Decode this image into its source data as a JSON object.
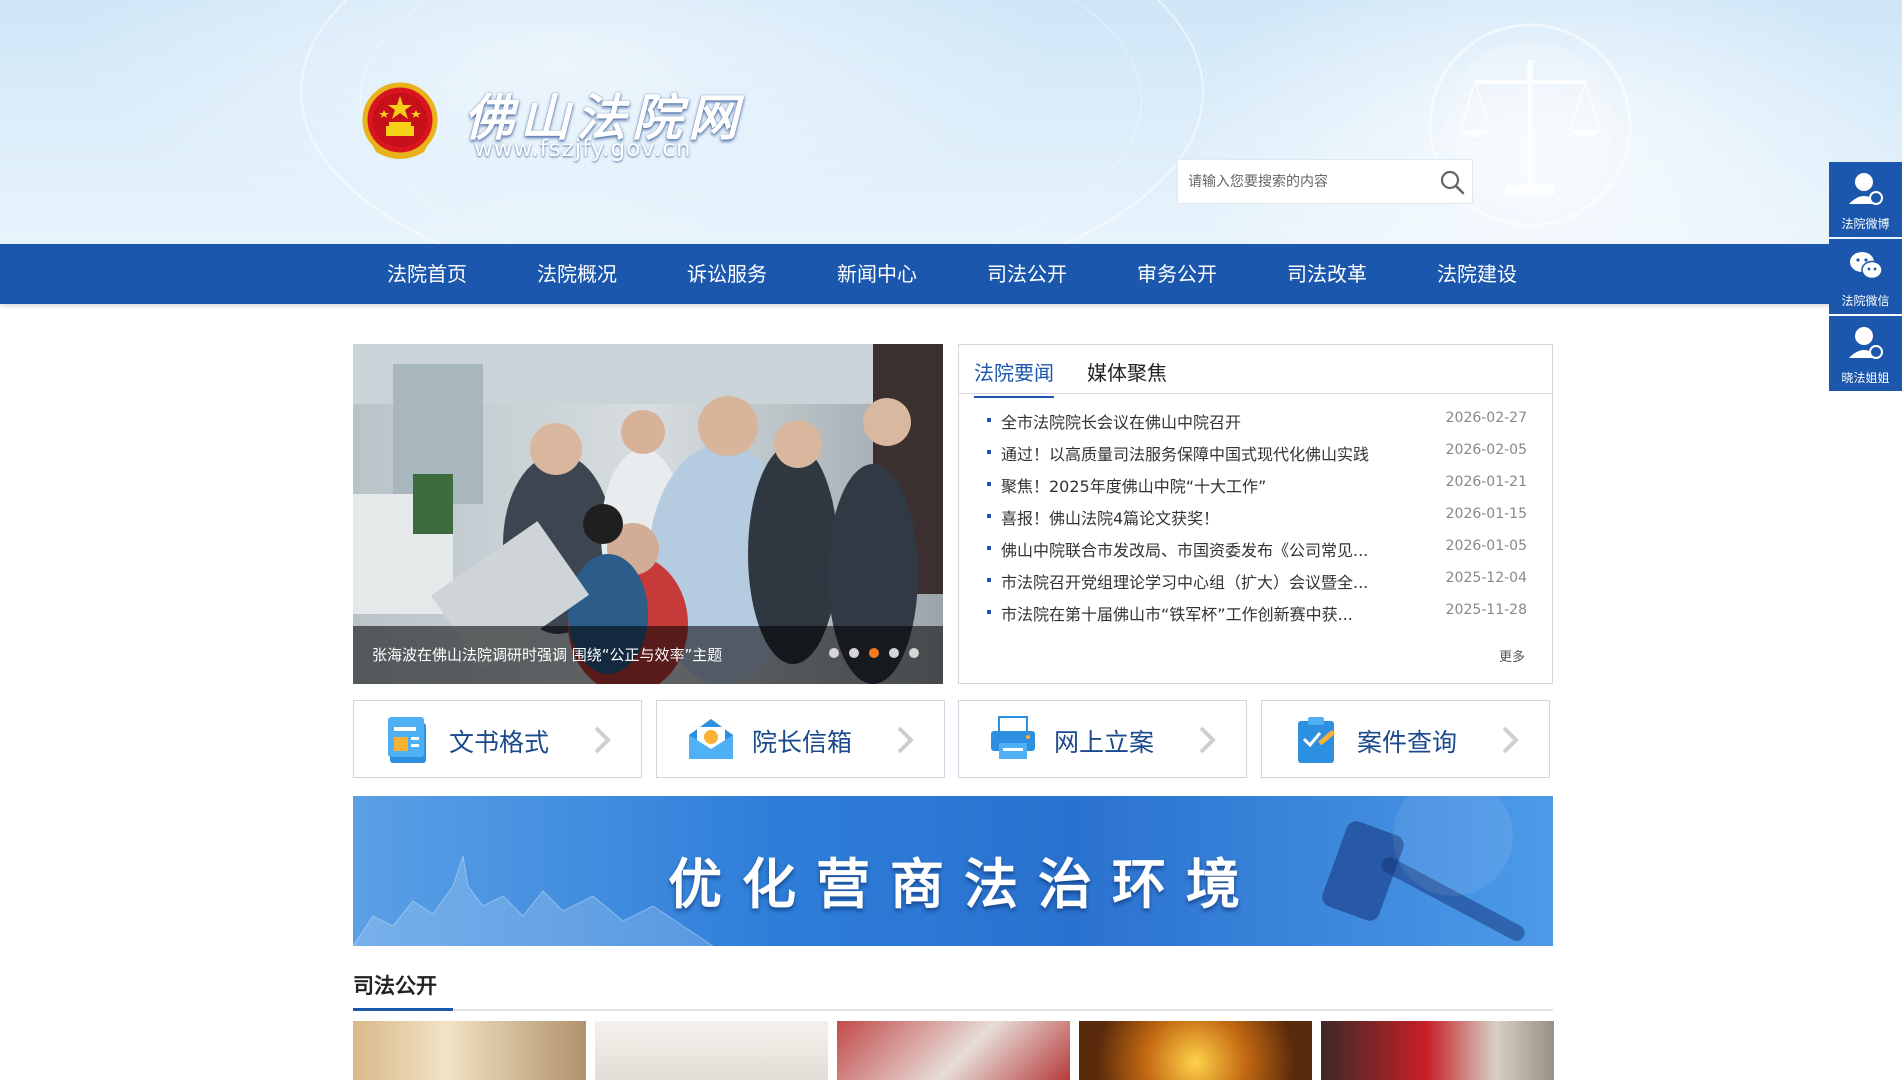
{
  "site": {
    "title": "佛山法院网",
    "url": "www.fszjfy.gov.cn"
  },
  "search": {
    "placeholder": "请输入您要搜索的内容"
  },
  "nav": {
    "items": [
      "法院首页",
      "法院概况",
      "诉讼服务",
      "新闻中心",
      "司法公开",
      "审务公开",
      "司法改革",
      "法院建设"
    ]
  },
  "side": {
    "items": [
      {
        "label": "法院微博",
        "icon": "person-icon"
      },
      {
        "label": "法院微信",
        "icon": "wechat-icon"
      },
      {
        "label": "晓法姐姐",
        "icon": "person-icon"
      }
    ]
  },
  "carousel": {
    "caption": "张海波在佛山法院调研时强调 围绕“公正与效率”主题",
    "slide_count": 5,
    "active_index": 3
  },
  "news": {
    "tabs": [
      "法院要闻",
      "媒体聚焦"
    ],
    "active_tab": 0,
    "items": [
      {
        "title": "全市法院院长会议在佛山中院召开",
        "date": "2026-02-27"
      },
      {
        "title": "通过！以高质量司法服务保障中国式现代化佛山实践",
        "date": "2026-02-05"
      },
      {
        "title": "聚焦！2025年度佛山中院“十大工作”",
        "date": "2026-01-21"
      },
      {
        "title": "喜报！佛山法院4篇论文获奖！",
        "date": "2026-01-15"
      },
      {
        "title": "佛山中院联合市发改局、市国资委发布《公司常见...",
        "date": "2026-01-05"
      },
      {
        "title": "市法院召开党组理论学习中心组（扩大）会议暨全...",
        "date": "2025-12-04"
      },
      {
        "title": "市法院在第十届佛山市“铁军杯”工作创新赛中获...",
        "date": "2025-11-28"
      }
    ],
    "more": "更多"
  },
  "quick_links": [
    {
      "label": "文书格式",
      "icon": "document-icon"
    },
    {
      "label": "院长信箱",
      "icon": "mailbox-icon"
    },
    {
      "label": "网上立案",
      "icon": "printer-icon"
    },
    {
      "label": "案件查询",
      "icon": "clipboard-icon"
    }
  ],
  "banner": {
    "text": "优化营商法治环境"
  },
  "section": {
    "title": "司法公开"
  },
  "colors": {
    "nav_bg": "#1a57ad",
    "accent": "#f57c1f",
    "link": "#1a4a8c"
  }
}
